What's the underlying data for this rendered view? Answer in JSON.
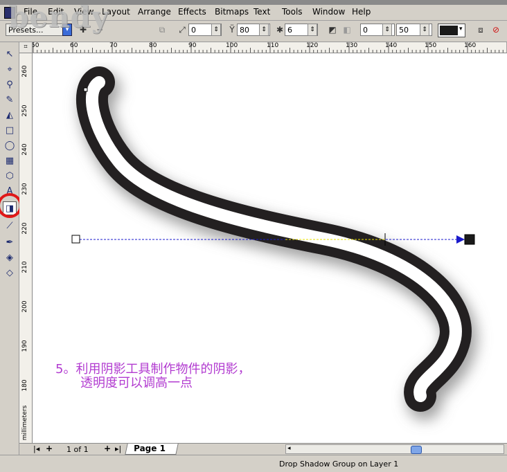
{
  "watermark": "bendy",
  "menu": [
    "File",
    "Edit",
    "View",
    "Layout",
    "Arrange",
    "Effects",
    "Bitmaps",
    "Text",
    "Tools",
    "Window",
    "Help"
  ],
  "propbar": {
    "presets_label": "Presets...",
    "offset_value": "0",
    "opacity_value": "80",
    "feather_value": "6",
    "fade_value": "0",
    "stretch_value": "50",
    "shadow_color": "#1a1a1a"
  },
  "rulers": {
    "horizontal": [
      "50",
      "60",
      "70",
      "80",
      "90",
      "100",
      "110",
      "120",
      "130",
      "140",
      "150",
      "160"
    ],
    "vertical": [
      "260",
      "250",
      "240",
      "230",
      "220",
      "210",
      "200",
      "190",
      "180"
    ],
    "unit": "millimeters"
  },
  "caption": {
    "line1": "5。利用阴影工具制作物件的阴影，",
    "line2": "透明度可以调高一点"
  },
  "pagebar": {
    "page_count": "1 of 1",
    "page_tab": "Page 1"
  },
  "status": {
    "text": "Drop Shadow Group on Layer 1"
  },
  "colors": {
    "stroke": "#232021",
    "caption": "#b23bd0",
    "highlight": "#e01818",
    "handle_line": "#1a1acc"
  },
  "icons": [
    "app-icon",
    "pick-tool-icon",
    "shape-tool-icon",
    "zoom-tool-icon",
    "freehand-tool-icon",
    "smart-fill-tool-icon",
    "rectangle-tool-icon",
    "ellipse-tool-icon",
    "graph-paper-tool-icon",
    "basic-shapes-tool-icon",
    "text-tool-icon",
    "interactive-drop-shadow-tool-icon",
    "eyedropper-tool-icon",
    "outline-tool-icon",
    "fill-tool-icon",
    "interactive-fill-tool-icon"
  ]
}
